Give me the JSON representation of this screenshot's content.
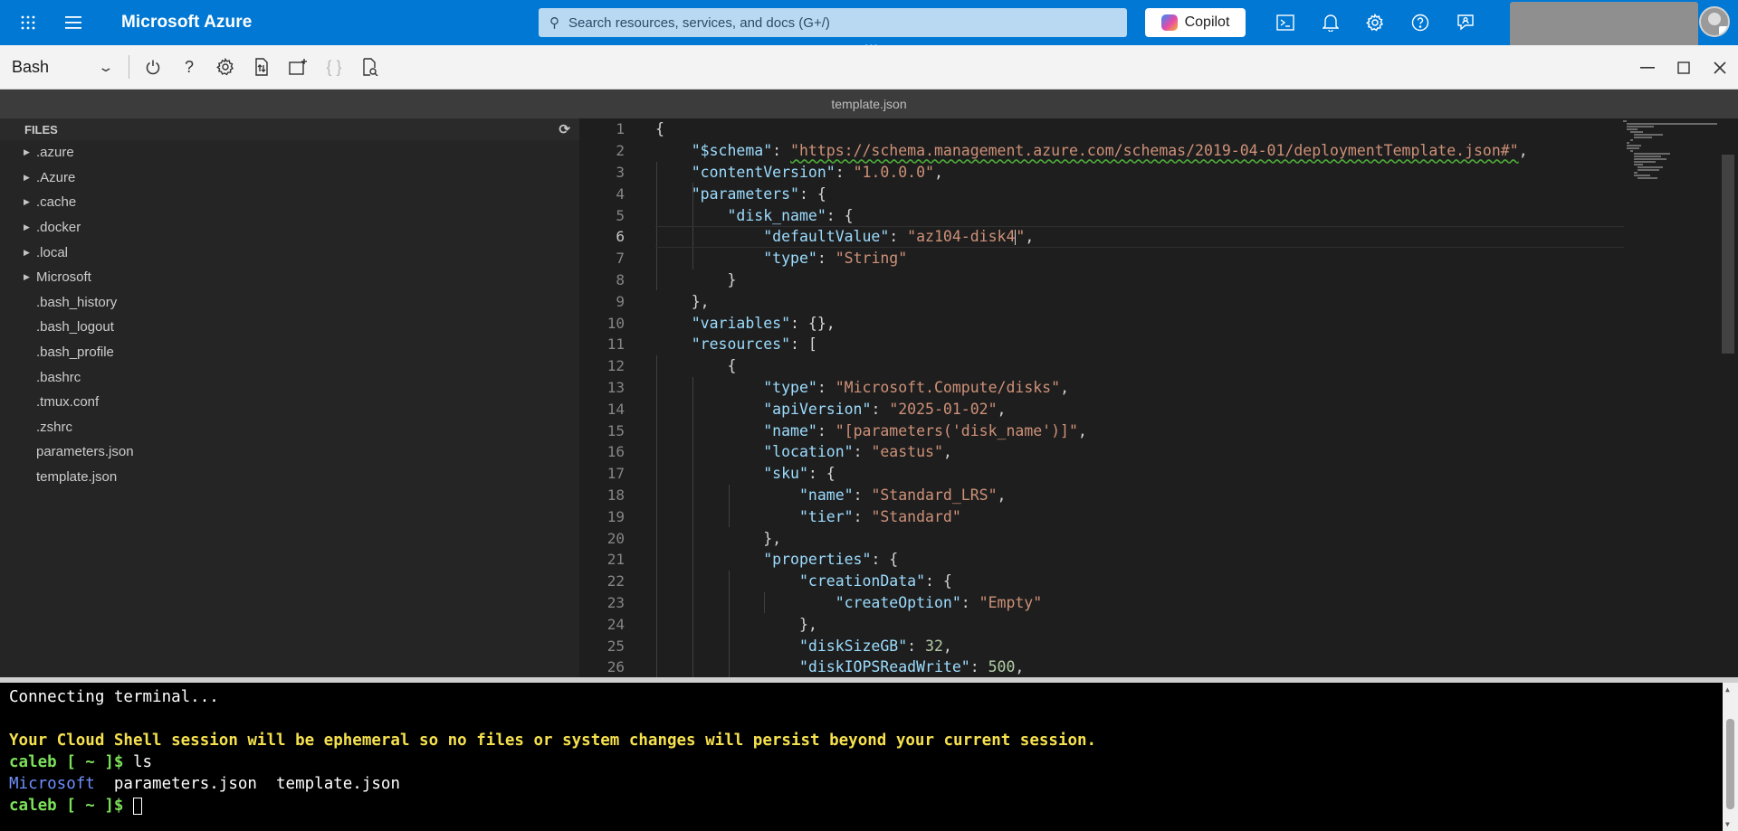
{
  "topbar": {
    "brand": "Microsoft Azure",
    "search_placeholder": "Search resources, services, and docs (G+/)",
    "copilot_label": "Copilot"
  },
  "toolbar": {
    "shell": "Bash"
  },
  "editor": {
    "tab_title": "template.json"
  },
  "files": {
    "header": "FILES",
    "items": [
      {
        "name": ".azure",
        "folder": true
      },
      {
        "name": ".Azure",
        "folder": true
      },
      {
        "name": ".cache",
        "folder": true
      },
      {
        "name": ".docker",
        "folder": true
      },
      {
        "name": ".local",
        "folder": true
      },
      {
        "name": "Microsoft",
        "folder": true
      },
      {
        "name": ".bash_history",
        "folder": false
      },
      {
        "name": ".bash_logout",
        "folder": false
      },
      {
        "name": ".bash_profile",
        "folder": false
      },
      {
        "name": ".bashrc",
        "folder": false
      },
      {
        "name": ".tmux.conf",
        "folder": false
      },
      {
        "name": ".zshrc",
        "folder": false
      },
      {
        "name": "parameters.json",
        "folder": false
      },
      {
        "name": "template.json",
        "folder": false
      }
    ]
  },
  "code_lines": [
    "{",
    "    \"$schema\": \"https://schema.management.azure.com/schemas/2019-04-01/deploymentTemplate.json#\",",
    "    \"contentVersion\": \"1.0.0.0\",",
    "    \"parameters\": {",
    "        \"disk_name\": {",
    "            \"defaultValue\": \"az104-disk4\",",
    "            \"type\": \"String\"",
    "        }",
    "    },",
    "    \"variables\": {},",
    "    \"resources\": [",
    "        {",
    "            \"type\": \"Microsoft.Compute/disks\",",
    "            \"apiVersion\": \"2025-01-02\",",
    "            \"name\": \"[parameters('disk_name')]\",",
    "            \"location\": \"eastus\",",
    "            \"sku\": {",
    "                \"name\": \"Standard_LRS\",",
    "                \"tier\": \"Standard\"",
    "            },",
    "            \"properties\": {",
    "                \"creationData\": {",
    "                    \"createOption\": \"Empty\"",
    "                },",
    "                \"diskSizeGB\": 32,",
    "                \"diskIOPSReadWrite\": 500,"
  ],
  "terminal": {
    "connecting": "Connecting terminal...",
    "warning": "Your Cloud Shell session will be ephemeral so no files or system changes will persist beyond your current session.",
    "prompt": "caleb [ ~ ]$",
    "command": " ls",
    "ls_dir": "Microsoft",
    "ls_files": "  parameters.json  template.json"
  }
}
